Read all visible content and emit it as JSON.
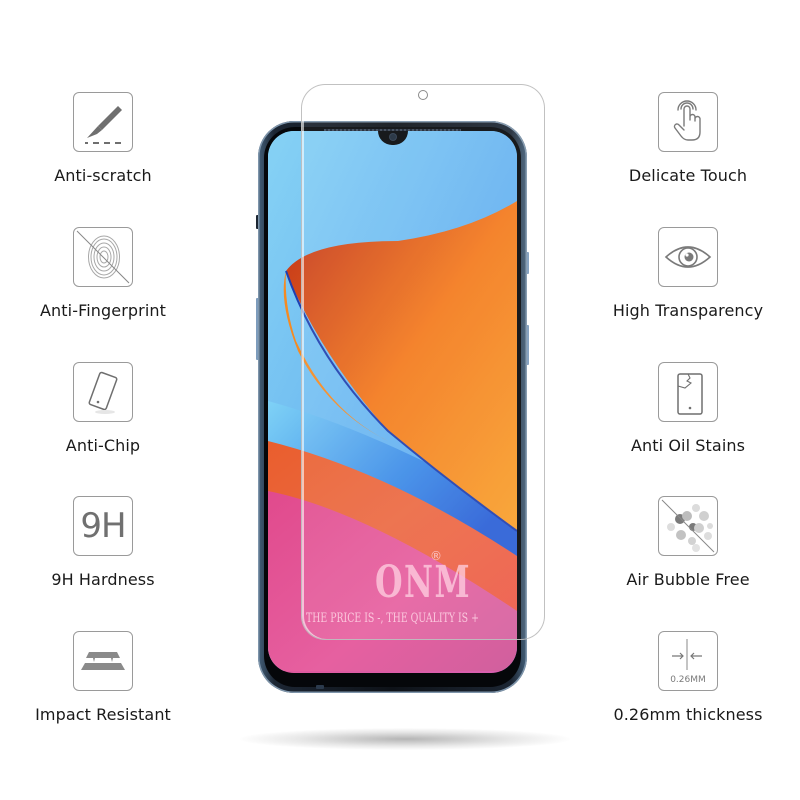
{
  "left_features": [
    {
      "label": "Anti-scratch",
      "icon": "scalpel-icon"
    },
    {
      "label": "Anti-Fingerprint",
      "icon": "fingerprint-icon"
    },
    {
      "label": "Anti-Chip",
      "icon": "tilted-phone-icon"
    },
    {
      "label": "9H Hardness",
      "icon": "9h-icon",
      "icon_text": "9H"
    },
    {
      "label": "Impact Resistant",
      "icon": "layers-icon"
    }
  ],
  "right_features": [
    {
      "label": "Delicate Touch",
      "icon": "touch-hand-icon"
    },
    {
      "label": "High Transparency",
      "icon": "eye-icon"
    },
    {
      "label": "Anti Oil Stains",
      "icon": "cracked-phone-icon"
    },
    {
      "label": "Air Bubble Free",
      "icon": "bubbles-icon"
    },
    {
      "label": "0.26mm thickness",
      "icon": "thickness-icon",
      "icon_text": "0.26MM"
    }
  ],
  "watermark": {
    "brand": "ONM",
    "registered": "®",
    "slogan": "THE PRICE IS -, THE QUALITY IS +"
  },
  "colors": {
    "icon_border": "#9a9a9a",
    "icon_fill": "#7a7a7a",
    "label_text": "#1a1a1a"
  }
}
